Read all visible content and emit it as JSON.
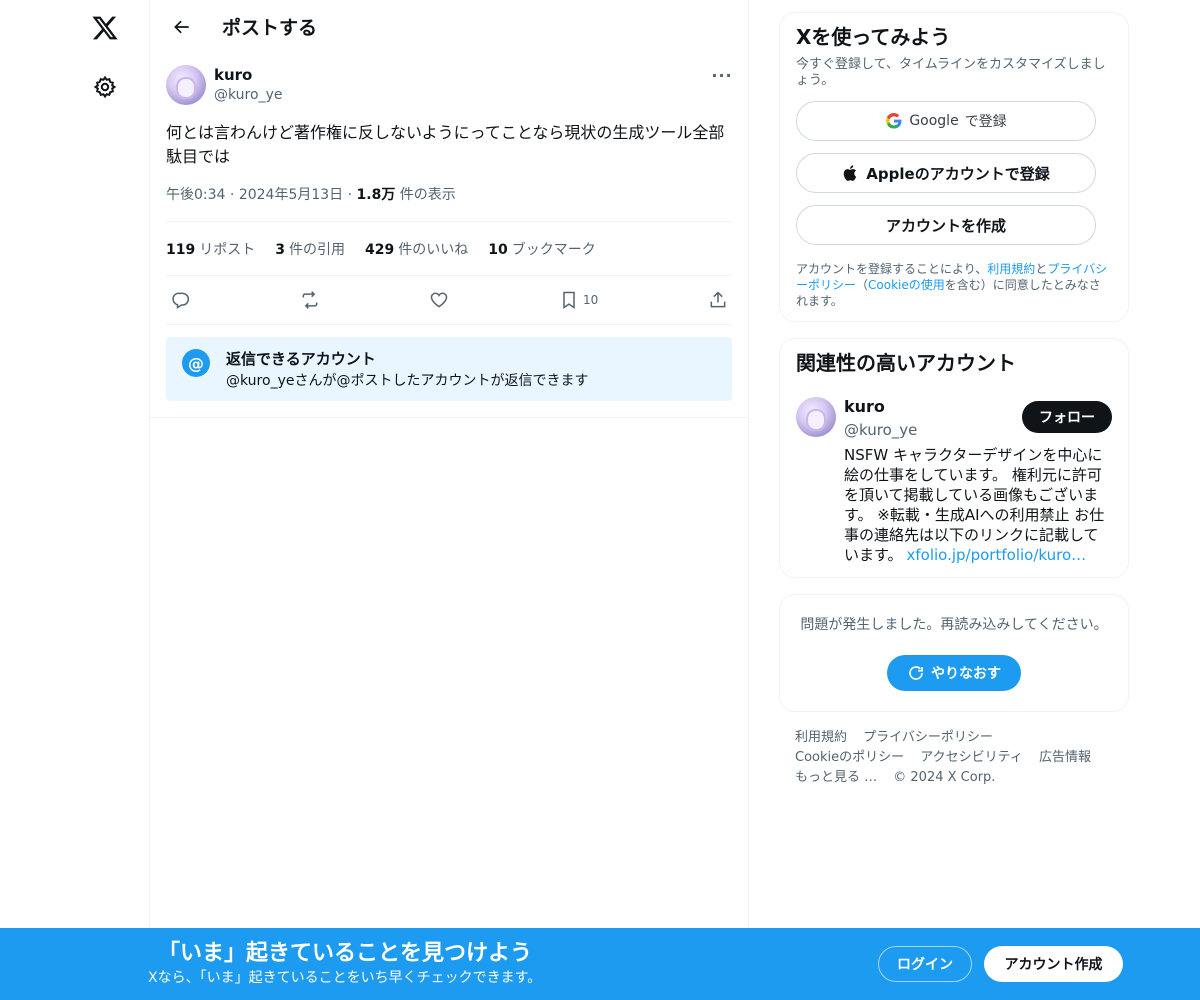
{
  "header": {
    "title": "ポストする"
  },
  "post": {
    "author_name": "kuro",
    "author_handle": "@kuro_ye",
    "more": "···",
    "text": "何とは言わんけど著作権に反しないようにってことなら現状の生成ツール全部駄目では",
    "time": "午後0:34",
    "date": "2024年5月13日",
    "views_count": "1.8万",
    "views_label": "件の表示",
    "sep": "·",
    "stats": [
      {
        "count": "119",
        "label": "リポスト"
      },
      {
        "count": "3",
        "label": "件の引用"
      },
      {
        "count": "429",
        "label": "件のいいね"
      },
      {
        "count": "10",
        "label": "ブックマーク"
      }
    ],
    "bookmark_count": "10"
  },
  "reply_box": {
    "icon": "@",
    "title": "返信できるアカウント",
    "subtitle": "@kuro_yeさんが@ポストしたアカウントが返信できます"
  },
  "signup_card": {
    "title": "Xを使ってみよう",
    "subtitle": "今すぐ登録して、タイムラインをカスタマイズしましょう。",
    "google_brand": "Google",
    "google_label": "で登録",
    "apple_label": "Appleのアカウントで登録",
    "create_label": "アカウントを作成",
    "legal_1": "アカウントを登録することにより、",
    "legal_terms": "利用規約",
    "legal_2": "と",
    "legal_privacy": "プライバシーポリシー",
    "legal_3": "（",
    "legal_cookie": "Cookieの使用",
    "legal_4": "を含む）に同意したとみなされます。"
  },
  "related_card": {
    "title": "関連性の高いアカウント",
    "name": "kuro",
    "handle": "@kuro_ye",
    "follow_label": "フォロー",
    "bio": "NSFW キャラクターデザインを中心に絵の仕事をしています。 権利元に許可を頂いて掲載している画像もございます。 ※転載・生成AIへの利用禁止 お仕事の連絡先は以下のリンクに記載しています。",
    "bio_link": "xfolio.jp/portfolio/kuro…"
  },
  "error_card": {
    "text": "問題が発生しました。再読み込みしてください。",
    "retry_label": "やりなおす"
  },
  "footer": {
    "links_line1": [
      "利用規約",
      "プライバシーポリシー"
    ],
    "links_line2": [
      "Cookieのポリシー",
      "アクセシビリティ",
      "広告情報"
    ],
    "more": "もっと見る …",
    "copyright": "© 2024 X Corp."
  },
  "banner": {
    "title": "「いま」起きていることを見つけよう",
    "subtitle": "Xなら、「いま」起きていることをいち早くチェックできます。",
    "login_label": "ログイン",
    "create_label": "アカウント作成"
  },
  "colors": {
    "accent": "#1d9bf0",
    "text": "#0f1419",
    "muted": "#536471",
    "border": "#eff3f4"
  }
}
